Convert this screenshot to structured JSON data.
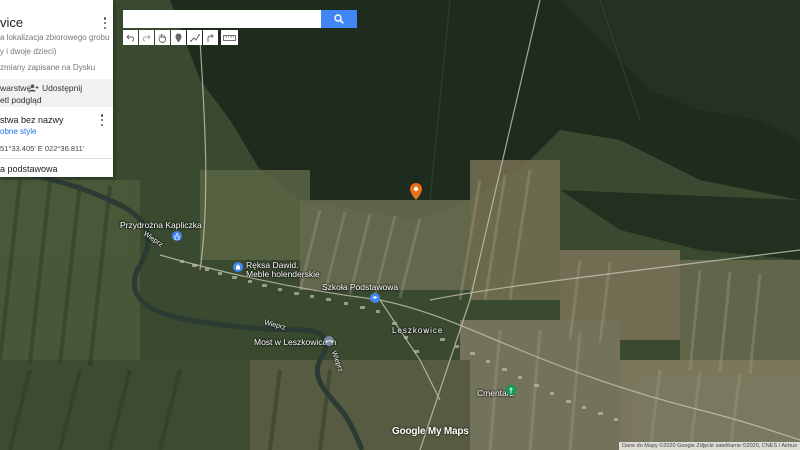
{
  "panel": {
    "title": "vice",
    "subtitle_1": "a lokalizacja zbiorowego grobu",
    "subtitle_2": "y i dwoje dzieci)",
    "subtitle_3": "zmiany zapisane na Dysku",
    "action_layers": "warstwę",
    "action_share": "Udostępnij",
    "action_preview": "etl podgląd",
    "layer_name": "stwa bez nazwy",
    "layer_style": "obne style",
    "coordinates": "51°33.405' E 022°36.811'",
    "basemap": "a podstawowa"
  },
  "search": {
    "value": "",
    "placeholder": ""
  },
  "toolbar": {
    "tools": [
      "undo-icon",
      "redo-icon",
      "hand-icon",
      "marker-icon",
      "draw-line-icon",
      "directions-icon",
      "ruler-icon"
    ]
  },
  "map": {
    "labels": {
      "chapel": "Przydrożna Kapliczka",
      "river_1": "Wieprz",
      "river_2": "Wieprz",
      "river_3": "Wieprz",
      "shop_line1": "Ręksa Dawid.",
      "shop_line2": "Meble holenderskie",
      "school": "Szkoła Podstawowa",
      "village": "Leszkowice",
      "bridge": "Most w Leszkowicach",
      "cemetery": "Cmentarz"
    },
    "logo": "Google My Maps",
    "attribution": "Dane do Mapy ©2020 Google Zdjęcie satelitarne ©2020, CNES / Airbus"
  },
  "colors": {
    "accent": "#4285f4",
    "marker": "#e8711a",
    "link": "#1a73e8"
  }
}
